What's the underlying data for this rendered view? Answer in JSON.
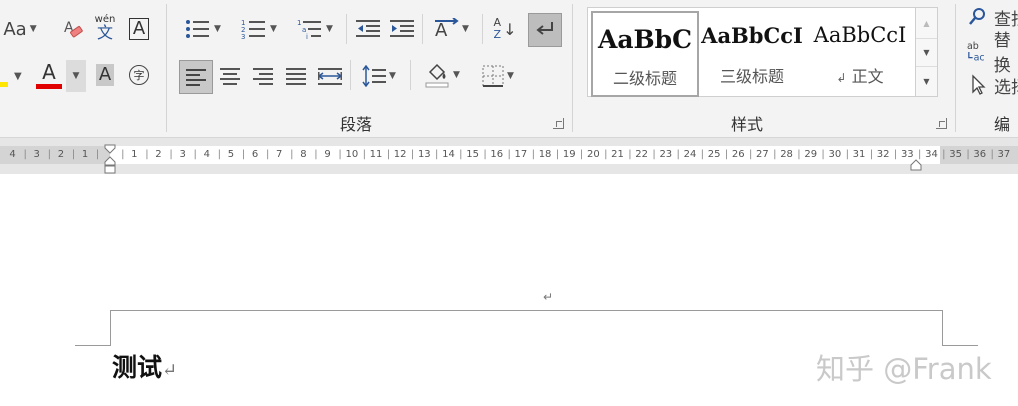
{
  "font_group": {
    "change_case_label": "Aa",
    "phonetic_top": "wén",
    "phonetic_bottom": "文",
    "font_color_letter": "A",
    "shading_letter": "A",
    "enclose_char": "字",
    "char_border_letter": "A"
  },
  "paragraph_group": {
    "label": "段落",
    "sort_top": "A",
    "sort_bottom": "Z"
  },
  "styles_group": {
    "label": "样式",
    "items": [
      {
        "preview": "AaBbC",
        "name": "二级标题"
      },
      {
        "preview": "AaBbCcI",
        "name": "三级标题"
      },
      {
        "preview": "AaBbCcI",
        "name": "正文",
        "mark": "↲"
      }
    ]
  },
  "editing_group": {
    "label": "编辑",
    "find": "查找",
    "replace": "替换",
    "select": "选择"
  },
  "ruler": {
    "left_ticks": [
      "4",
      "3",
      "2",
      "1"
    ],
    "right_ticks": [
      "1",
      "2",
      "3",
      "4",
      "5",
      "6",
      "7",
      "8",
      "9",
      "10",
      "11",
      "12",
      "13",
      "14",
      "15",
      "16",
      "17",
      "18",
      "19",
      "20",
      "21",
      "22",
      "23",
      "24",
      "25",
      "26",
      "27",
      "28",
      "29",
      "30",
      "31",
      "32",
      "33",
      "34",
      "35",
      "36",
      "37"
    ]
  },
  "document": {
    "header_mark": "↵",
    "body_text": "测试",
    "body_mark": "↵",
    "watermark": "知乎 @Frank"
  },
  "colors": {
    "ribbon_bg": "#f3f3f3",
    "font_color_bar": "#e00000",
    "highlight_yellow": "#ffe600",
    "active_blue": "#2b579a"
  }
}
